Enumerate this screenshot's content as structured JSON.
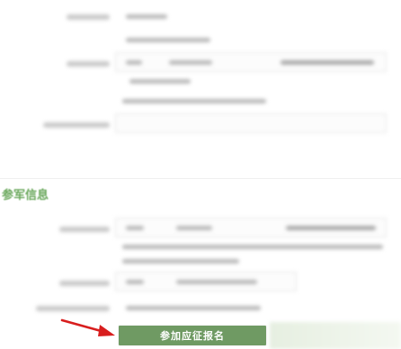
{
  "sections": {
    "military_info_title": "参军信息"
  },
  "actions": {
    "apply_button_label": "参加应征报名"
  },
  "colors": {
    "accent_green": "#6aa85c",
    "button_green": "#6f9a63",
    "arrow_red": "#d81e1e"
  },
  "icons": {
    "pointer": "red-arrow-icon"
  }
}
